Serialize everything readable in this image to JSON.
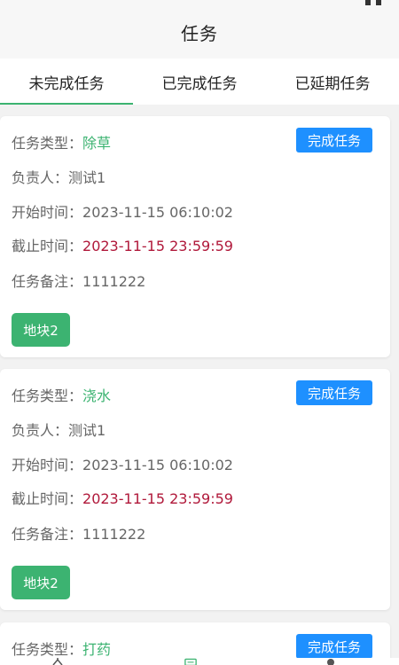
{
  "navbar": {
    "title": "任务"
  },
  "tabs": [
    {
      "label": "未完成任务",
      "active": true
    },
    {
      "label": "已完成任务",
      "active": false
    },
    {
      "label": "已延期任务",
      "active": false
    }
  ],
  "labels": {
    "type": "任务类型：",
    "owner": "负责人：",
    "start": "开始时间：",
    "deadline": "截止时间：",
    "note": "任务备注："
  },
  "tasks": [
    {
      "type": "除草",
      "owner": "测试1",
      "start": "2023-11-15 06:10:02",
      "deadline": "2023-11-15 23:59:59",
      "note": "1111222",
      "plot": "地块2",
      "complete_label": "完成任务"
    },
    {
      "type": "浇水",
      "owner": "测试1",
      "start": "2023-11-15 06:10:02",
      "deadline": "2023-11-15 23:59:59",
      "note": "1111222",
      "plot": "地块2",
      "complete_label": "完成任务"
    },
    {
      "type": "打药",
      "complete_label": "完成任务"
    }
  ],
  "colors": {
    "accent_green": "#3cb371",
    "button_blue": "#1e90ff",
    "deadline_red": "#b0183a"
  }
}
